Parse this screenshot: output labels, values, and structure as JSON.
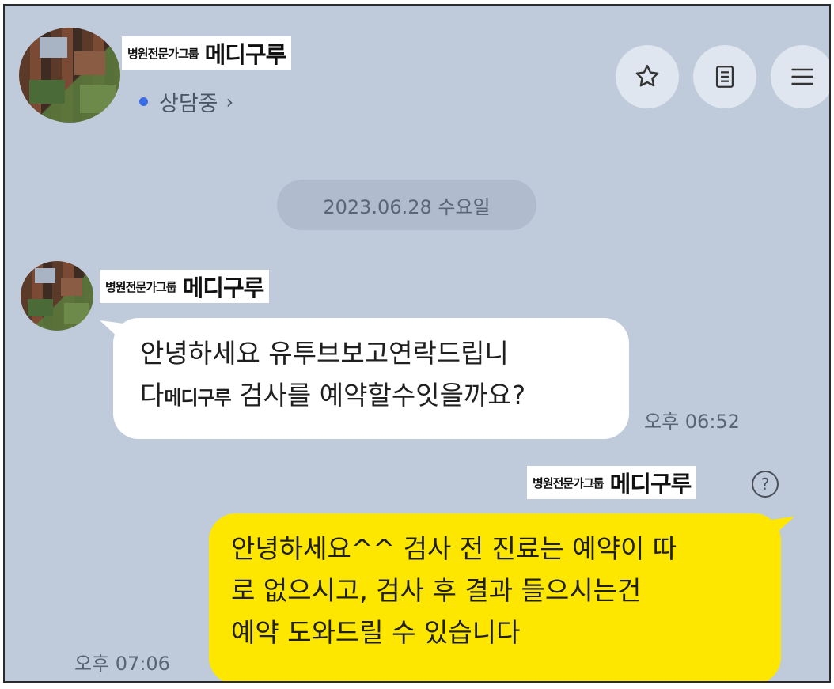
{
  "header": {
    "channel_prefix": "병원전문가그룹",
    "channel_name": "메디구루",
    "status": "상담중",
    "status_chevron": "›",
    "status_dot_color": "#3b6de5",
    "buttons": [
      "star-icon",
      "document-list-icon",
      "menu-icon"
    ]
  },
  "date_divider": "2023.06.28 수요일",
  "messages": [
    {
      "direction": "incoming",
      "sender_prefix": "병원전문가그룹",
      "sender_name": "메디구루",
      "line1": "안녕하세요 유투브보고연락드립니",
      "line2_prefix": "다",
      "line2_strong": "메디구루",
      "line2_rest": " 검사를 예약할수잇을까요?",
      "time": "오후 06:52",
      "bubble_color": "#ffffff"
    },
    {
      "direction": "outgoing",
      "sender_prefix": "병원전문가그룹",
      "sender_name": "메디구루",
      "help_glyph": "?",
      "lines": [
        "안녕하세요^^ 검사 전 진료는 예약이 따",
        "로 없으시고, 검사 후 결과 들으시는건",
        "예약 도와드릴 수 있습니다"
      ],
      "time": "오후 07:06",
      "bubble_color": "#fde600"
    }
  ]
}
